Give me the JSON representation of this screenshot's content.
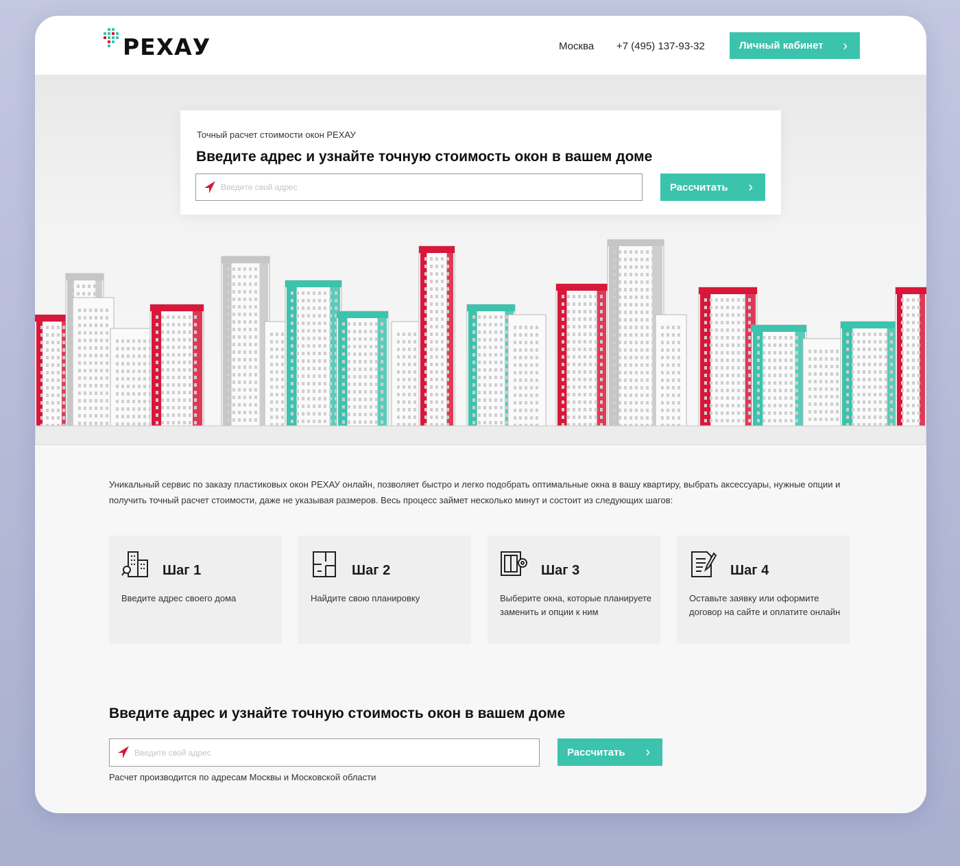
{
  "header": {
    "logo_text": "РЕХАУ",
    "city": "Москва",
    "phone": "+7 (495) 137-93-32",
    "account_button": "Личный кабинет"
  },
  "hero": {
    "subtitle": "Точный расчет стоимости окон РЕХАУ",
    "title": "Введите адрес и узнайте точную стоимость окон в вашем доме",
    "address_placeholder": "Введите свой адрес",
    "calc_button": "Рассчитать"
  },
  "intro": "Уникальный сервис по заказу пластиковых окон РЕХАУ онлайн, позволяет быстро и легко подобрать оптимальные окна в вашу квартиру, выбрать аксессуары, нужные опции и получить точный расчет стоимости, даже не указывая размеров. Весь процесс займет несколько минут и состоит из следующих шагов:",
  "steps": [
    {
      "title": "Шаг 1",
      "text": "Введите адрес своего дома",
      "icon": "building-search-icon"
    },
    {
      "title": "Шаг 2",
      "text": "Найдите свою планировку",
      "icon": "floor-plan-icon"
    },
    {
      "title": "Шаг 3",
      "text": "Выберите окна, которые планируете заменить и опции к ним",
      "icon": "window-settings-icon"
    },
    {
      "title": "Шаг 4",
      "text": "Оставьте заявку или оформите договор на сайте и оплатите онлайн",
      "icon": "document-pen-icon"
    }
  ],
  "bottom": {
    "title": "Введите адрес и узнайте точную стоимость окон в вашем доме",
    "address_placeholder": "Введите свой адрес",
    "calc_button": "Рассчитать",
    "note": "Расчет производится по адресам Москвы и Московской области"
  },
  "colors": {
    "accent": "#3cc3ad",
    "brand_red": "#d8173a",
    "gray_building": "#c6c6c6"
  }
}
